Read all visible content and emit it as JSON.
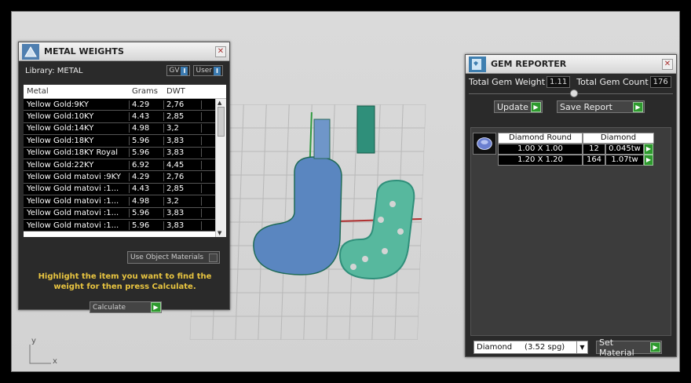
{
  "metal_weights": {
    "title": "METAL WEIGHTS",
    "library_label": "Library: METAL",
    "gv_label": "GV",
    "user_label": "User",
    "toggle_glyph": "I",
    "columns": [
      "Metal",
      "Grams",
      "DWT"
    ],
    "rows": [
      [
        "Yellow Gold:9KY",
        "4.29",
        "2,76"
      ],
      [
        "Yellow Gold:10KY",
        "4.43",
        "2,85"
      ],
      [
        "Yellow Gold:14KY",
        "4.98",
        "3,2"
      ],
      [
        "Yellow Gold:18KY",
        "5.96",
        "3,83"
      ],
      [
        "Yellow Gold:18KY Royal",
        "5.96",
        "3,83"
      ],
      [
        "Yellow Gold:22KY",
        "6.92",
        "4,45"
      ],
      [
        "Yellow Gold matovi :9KY",
        "4.29",
        "2,76"
      ],
      [
        "Yellow Gold matovi :1...",
        "4.43",
        "2,85"
      ],
      [
        "Yellow Gold matovi :1...",
        "4.98",
        "3,2"
      ],
      [
        "Yellow Gold matovi :1...",
        "5.96",
        "3,83"
      ],
      [
        "Yellow Gold matovi :1...",
        "5.96",
        "3,83"
      ]
    ],
    "use_object_materials": "Use Object Materials",
    "hint": "Highlight the item you want to find the weight for then press Calculate.",
    "calculate": "Calculate"
  },
  "gem_reporter": {
    "title": "GEM REPORTER",
    "total_weight_label": "Total Gem Weight",
    "total_weight_value": "1.11",
    "total_count_label": "Total Gem Count",
    "total_count_value": "176",
    "update": "Update",
    "save_report": "Save Report",
    "header": [
      "Diamond Round",
      "Diamond"
    ],
    "gems": [
      [
        "1.00 X 1.00",
        "12",
        "0.045tw"
      ],
      [
        "1.20 X 1.20",
        "164",
        "1.07tw"
      ]
    ],
    "material_select": "Diamond     (3.52 spg)",
    "set_material": "Set Material"
  },
  "viewport": {
    "axis_y": "y",
    "axis_x": "x"
  },
  "colors": {
    "accent_green": "#2e9a2e",
    "hint_yellow": "#e8c440",
    "model_teal": "#2f8f7a"
  }
}
